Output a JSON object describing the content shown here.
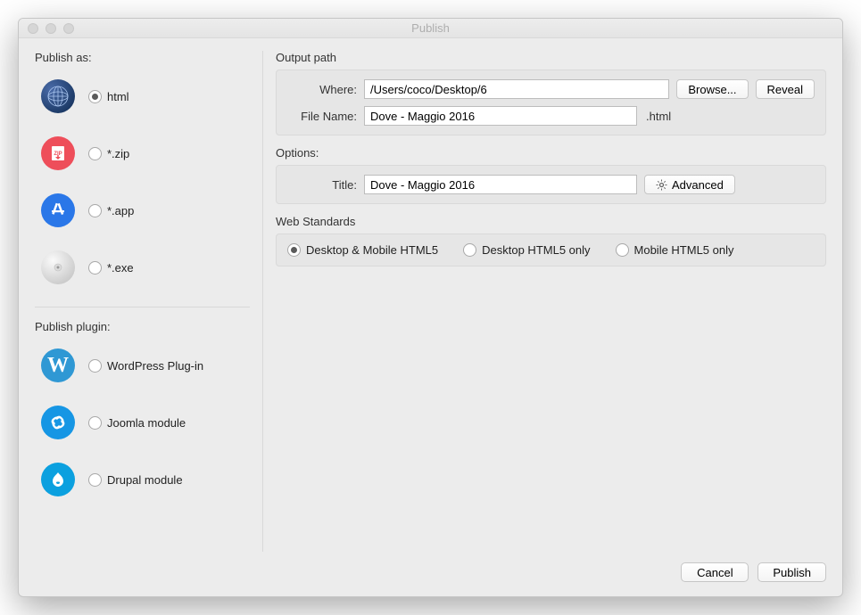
{
  "window": {
    "title": "Publish"
  },
  "left": {
    "publish_as_label": "Publish as:",
    "publish_plugin_label": "Publish plugin:",
    "formats": {
      "html": "html",
      "zip": "*.zip",
      "app": "*.app",
      "exe": "*.exe"
    },
    "plugins": {
      "wordpress": "WordPress Plug-in",
      "joomla": "Joomla module",
      "drupal": "Drupal module"
    }
  },
  "output": {
    "section_label": "Output path",
    "where_label": "Where:",
    "where_value": "/Users/coco/Desktop/6",
    "browse": "Browse...",
    "reveal": "Reveal",
    "filename_label": "File Name:",
    "filename_value": "Dove - Maggio 2016",
    "ext": ".html"
  },
  "options": {
    "section_label": "Options:",
    "title_label": "Title:",
    "title_value": "Dove - Maggio 2016",
    "advanced": "Advanced"
  },
  "webstd": {
    "section_label": "Web Standards",
    "r1": "Desktop & Mobile HTML5",
    "r2": "Desktop HTML5 only",
    "r3": "Mobile HTML5 only"
  },
  "footer": {
    "cancel": "Cancel",
    "publish": "Publish"
  }
}
